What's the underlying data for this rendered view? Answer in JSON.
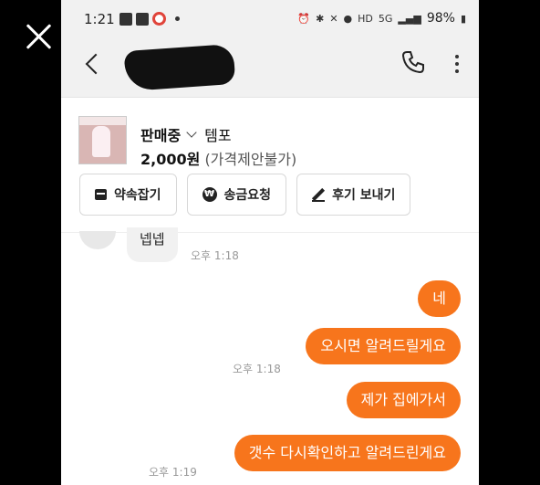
{
  "overlay": {
    "close_icon": "close-icon"
  },
  "status_bar": {
    "time": "1:21",
    "signal_text": "HD",
    "network": "5G",
    "battery": "98%"
  },
  "header": {
    "back_icon": "back-arrow-icon",
    "call_icon": "phone-icon",
    "more_icon": "more-vert-icon"
  },
  "product": {
    "status": "판매중",
    "title": "템포",
    "price": "2,000원",
    "price_note": "(가격제안불가)"
  },
  "actions": [
    {
      "label": "약속잡기",
      "icon": "calendar-icon"
    },
    {
      "label": "송금요청",
      "icon": "won-icon"
    },
    {
      "label": "후기 보내기",
      "icon": "pencil-icon"
    }
  ],
  "messages": {
    "incoming": {
      "text": "넵넵",
      "time": "오후 1:18"
    },
    "outgoing": [
      {
        "text": "네",
        "time": ""
      },
      {
        "text": "오시면 알려드릴게요",
        "time": "오후 1:18"
      },
      {
        "text": "제가 집에가서",
        "time": ""
      },
      {
        "text": "갯수 다시확인하고 알려드린게요",
        "time": "오후 1:19"
      }
    ]
  },
  "colors": {
    "accent": "#f7751c"
  }
}
